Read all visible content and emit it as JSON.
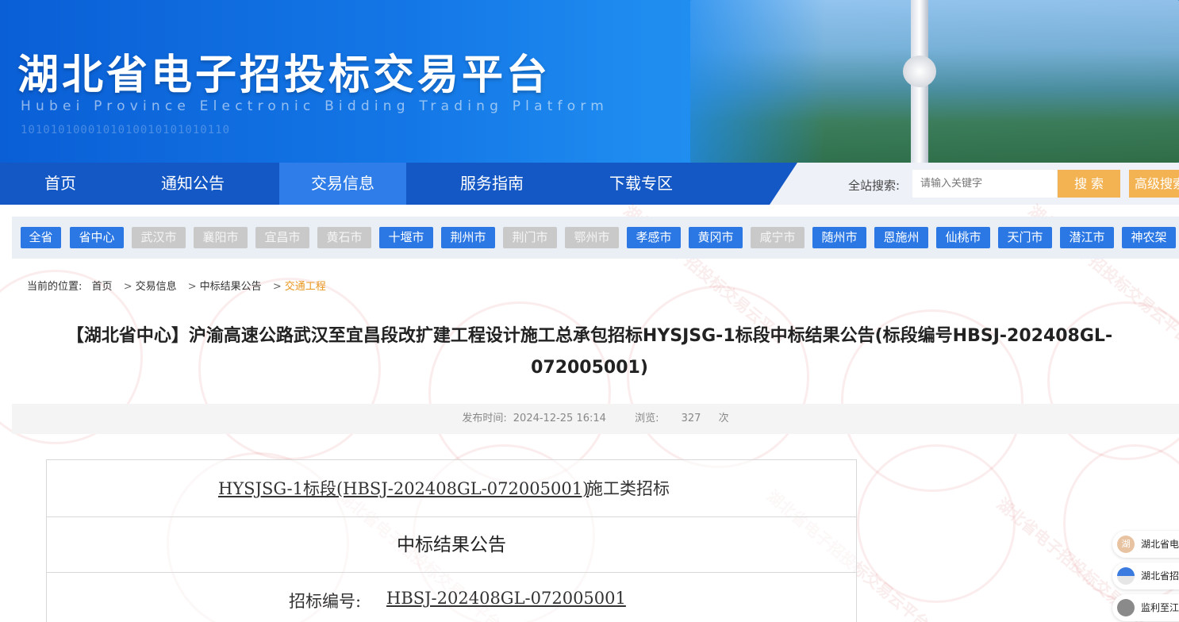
{
  "banner": {
    "title": "湖北省电子招投标交易平台",
    "subtitle": "Hubei Province Electronic Bidding Trading Platform",
    "binary": "1010101000101010010101010110"
  },
  "nav": {
    "items": [
      {
        "label": "首页"
      },
      {
        "label": "通知公告"
      },
      {
        "label": "交易信息"
      },
      {
        "label": "服务指南"
      },
      {
        "label": "下载专区"
      }
    ],
    "search_label": "全站搜索:",
    "search_placeholder": "请输入关键字",
    "search_button": "搜 索",
    "advanced_button": "高级搜索"
  },
  "cities": [
    {
      "label": "全省",
      "style": "blue"
    },
    {
      "label": "省中心",
      "style": "blue"
    },
    {
      "label": "武汉市",
      "style": "gray"
    },
    {
      "label": "襄阳市",
      "style": "gray"
    },
    {
      "label": "宜昌市",
      "style": "gray"
    },
    {
      "label": "黄石市",
      "style": "gray"
    },
    {
      "label": "十堰市",
      "style": "blue"
    },
    {
      "label": "荆州市",
      "style": "blue"
    },
    {
      "label": "荆门市",
      "style": "gray"
    },
    {
      "label": "鄂州市",
      "style": "gray"
    },
    {
      "label": "孝感市",
      "style": "blue"
    },
    {
      "label": "黄冈市",
      "style": "blue"
    },
    {
      "label": "咸宁市",
      "style": "gray"
    },
    {
      "label": "随州市",
      "style": "blue"
    },
    {
      "label": "恩施州",
      "style": "blue"
    },
    {
      "label": "仙桃市",
      "style": "blue"
    },
    {
      "label": "天门市",
      "style": "blue"
    },
    {
      "label": "潜江市",
      "style": "blue"
    },
    {
      "label": "神农架",
      "style": "blue"
    }
  ],
  "breadcrumb": {
    "prefix": "当前的位置:",
    "items": [
      "首页",
      "交易信息",
      "中标结果公告"
    ],
    "current": "交通工程"
  },
  "article": {
    "title": "【湖北省中心】沪渝高速公路武汉至宜昌段改扩建工程设计施工总承包招标HYSJSG-1标段中标结果公告(标段编号HBSJ-202408GL-072005001)",
    "publish_label": "发布时间:",
    "publish_time": "2024-12-25 16:14",
    "views_label": "浏览:",
    "views": "327",
    "views_unit": "次"
  },
  "content": {
    "section_link": "HYSJSG-1标段(HBSJ-202408GL-072005001)",
    "section_suffix": "施工类招标",
    "heading": "中标结果公告",
    "bid_no_label": "招标编号:",
    "bid_no": "HBSJ-202408GL-072005001"
  },
  "side_links": [
    {
      "icon": "湖",
      "label": "湖北省电"
    },
    {
      "label": "湖北省招"
    },
    {
      "label": "监利至江"
    }
  ],
  "watermark": "湖北省电子招投标交易云平台"
}
